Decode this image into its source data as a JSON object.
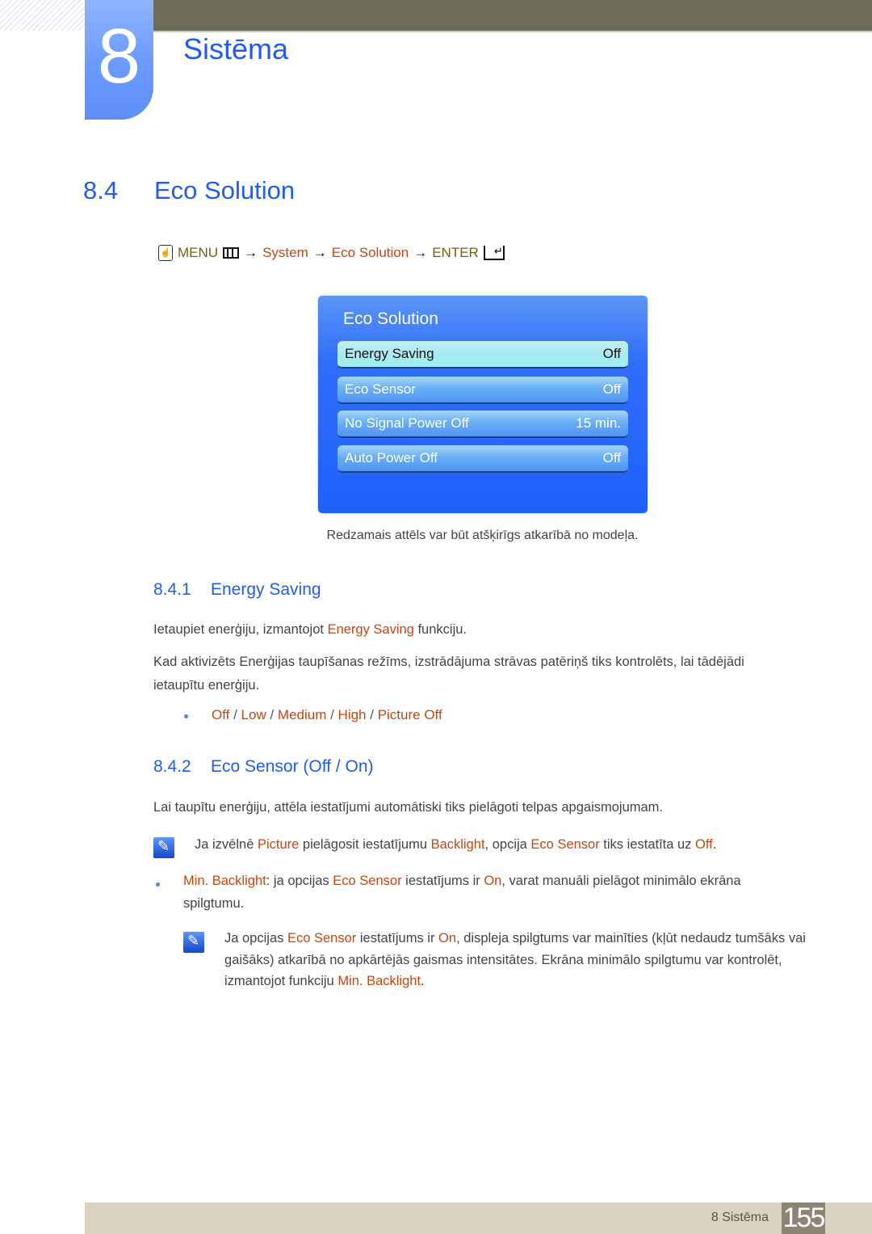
{
  "chapter": {
    "number": "8",
    "title": "Sistēma"
  },
  "section": {
    "number": "8.4",
    "title": "Eco Solution"
  },
  "menu_path": {
    "icon_hand": "remote-hand-icon",
    "menu": "MENU",
    "arrow": "→",
    "system": "System",
    "eco_solution": "Eco Solution",
    "enter": "ENTER"
  },
  "osd": {
    "title": "Eco Solution",
    "rows": [
      {
        "label": "Energy Saving",
        "value": "Off",
        "selected": true
      },
      {
        "label": "Eco Sensor",
        "value": "Off",
        "selected": false
      },
      {
        "label": "No Signal Power Off",
        "value": "15 min.",
        "selected": false
      },
      {
        "label": "Auto Power Off",
        "value": "Off",
        "selected": false
      }
    ]
  },
  "caption": "Redzamais attēls var būt atšķirīgs atkarībā no modeļa.",
  "sub1": {
    "number": "8.4.1",
    "title": "Energy Saving",
    "p1_pre": "Ietaupiet enerģiju, izmantojot ",
    "p1_hl": "Energy Saving",
    "p1_post": " funkciju.",
    "p2": "Kad aktivizēts Enerģijas taupīšanas režīms, izstrādājuma strāvas patēriņš tiks kontrolēts, lai tādējādi ietaupītu enerģiju.",
    "options": [
      "Off",
      "Low",
      "Medium",
      "High",
      "Picture Off"
    ],
    "sep": " / "
  },
  "sub2": {
    "number": "8.4.2",
    "title": "Eco Sensor (Off / On)",
    "p1": "Lai taupītu enerģiju, attēla iestatījumi automātiski tiks pielāgoti telpas apgaismojumam.",
    "note1": [
      "Ja izvēlnē ",
      "Picture",
      " pielāgosit iestatījumu ",
      "Backlight",
      ", opcija ",
      "Eco Sensor",
      " tiks iestatīta uz ",
      "Off",
      "."
    ],
    "bullet": [
      "Min. Backlight",
      ": ja opcijas ",
      "Eco Sensor",
      " iestatījums ir ",
      "On",
      ", varat manuāli pielāgot minimālo ekrāna spilgtumu."
    ],
    "note2": [
      "Ja opcijas ",
      "Eco Sensor",
      " iestatījums ir ",
      "On",
      ", displeja spilgtums var mainīties (kļūt nedaudz tumšāks vai gaišāks) atkarībā no apkārtējās gaismas intensitātes. Ekrāna minimālo spilgtumu var kontrolēt, izmantojot funkciju ",
      "Min. Backlight",
      "."
    ]
  },
  "footer": {
    "label": "8 Sistēma",
    "page": "155"
  }
}
